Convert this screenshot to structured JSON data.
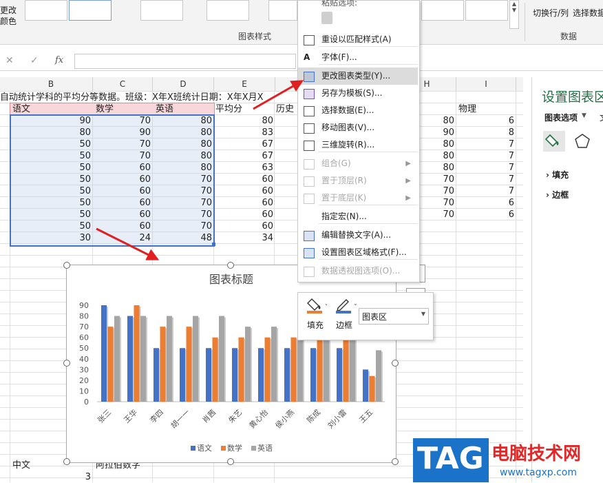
{
  "ribbon": {
    "left_label_1": "更改",
    "left_label_2": "颜色",
    "chart_styles_group": "图表样式",
    "switch_row_col": "切换行/列",
    "select_data": "选择数据",
    "data_group": "数据"
  },
  "formula_bar": {
    "cancel": "✕",
    "enter": "✓",
    "fx": "fx"
  },
  "columns": [
    "B",
    "C",
    "D",
    "E",
    "H",
    "I"
  ],
  "sheet": {
    "title_row": "自动统计学科的平均分等数据。班级：X年X班统计日期：X年X月X",
    "headers": [
      "语文",
      "数学",
      "英语",
      "平均分",
      "历史"
    ],
    "physics_header": "物理",
    "rows": [
      [
        90,
        70,
        80,
        80
      ],
      [
        80,
        90,
        80,
        83
      ],
      [
        50,
        70,
        80,
        67
      ],
      [
        50,
        70,
        80,
        67
      ],
      [
        50,
        60,
        80,
        63
      ],
      [
        50,
        60,
        70,
        60
      ],
      [
        50,
        60,
        70,
        60
      ],
      [
        50,
        60,
        70,
        60
      ],
      [
        50,
        60,
        70,
        60
      ],
      [
        50,
        60,
        70,
        60
      ],
      [
        30,
        24,
        48,
        34
      ]
    ],
    "col_h": [
      80,
      90,
      80,
      80,
      80,
      70,
      70,
      70,
      70
    ],
    "col_i": [
      "6",
      "8",
      "7",
      "7",
      "7",
      "7",
      "7",
      "6",
      "6"
    ],
    "bottom_a": "中文",
    "bottom_c": "阿拉伯数字",
    "bottom_num": "3"
  },
  "chart_data": {
    "type": "bar",
    "title": "图表标题",
    "categories": [
      "张三",
      "王华",
      "李四",
      "胡一一",
      "肖茜",
      "朱艺",
      "黄心怡",
      "侯小燕",
      "陈成",
      "刘小雷",
      "王五"
    ],
    "series": [
      {
        "name": "语文",
        "values": [
          90,
          80,
          50,
          50,
          50,
          50,
          50,
          50,
          50,
          50,
          30
        ],
        "color": "#4472c4"
      },
      {
        "name": "数学",
        "values": [
          70,
          90,
          70,
          70,
          60,
          60,
          60,
          60,
          60,
          60,
          24
        ],
        "color": "#ed7d31"
      },
      {
        "name": "英语",
        "values": [
          80,
          80,
          80,
          80,
          80,
          70,
          70,
          70,
          70,
          70,
          48
        ],
        "color": "#a5a5a5"
      }
    ],
    "ylim": [
      0,
      90
    ],
    "yticks": [
      0,
      10,
      20,
      30,
      40,
      50,
      60,
      70,
      80,
      90
    ],
    "legend": "bottom",
    "grid": false
  },
  "context_menu": {
    "paste_options": "粘贴选项:",
    "items": [
      {
        "label": "重设以匹配样式(A)",
        "disabled": false,
        "icon": "reset-style-icon"
      },
      {
        "label": "字体(F)...",
        "disabled": false,
        "icon": "font-icon"
      },
      {
        "label": "更改图表类型(Y)...",
        "disabled": false,
        "icon": "change-chart-type-icon",
        "highlight": true
      },
      {
        "label": "另存为模板(S)...",
        "disabled": false,
        "icon": "save-template-icon"
      },
      {
        "label": "选择数据(E)...",
        "disabled": false,
        "icon": "select-data-icon"
      },
      {
        "label": "移动图表(V)...",
        "disabled": false,
        "icon": "move-chart-icon"
      },
      {
        "label": "三维旋转(R)...",
        "disabled": false,
        "icon": "3d-rotate-icon"
      },
      {
        "label": "组合(G)",
        "disabled": true,
        "icon": "group-icon",
        "submenu": true
      },
      {
        "label": "置于顶层(R)",
        "disabled": true,
        "icon": "bring-front-icon",
        "submenu": true
      },
      {
        "label": "置于底层(K)",
        "disabled": true,
        "icon": "send-back-icon",
        "submenu": true
      },
      {
        "label": "指定宏(N)...",
        "disabled": false,
        "icon": "none"
      },
      {
        "label": "编辑替换文字(A)...",
        "disabled": false,
        "icon": "alt-text-icon"
      },
      {
        "label": "设置图表区域格式(F)...",
        "disabled": false,
        "icon": "format-area-icon"
      },
      {
        "label": "数据透视图选项(O)...",
        "disabled": true,
        "icon": "pivot-options-icon"
      }
    ]
  },
  "mini_toolbar": {
    "fill": "填充",
    "border": "边框",
    "dropdown_value": "图表区"
  },
  "side_panel": {
    "title": "设置图表区",
    "tab": "图表选项",
    "tab_extra": "文",
    "fill": "填充",
    "border": "边框"
  },
  "watermark": {
    "tag": "TAG",
    "site_name": "电脑技术网",
    "url": "www.tagxp.com"
  },
  "colors": {
    "accent": "#4472c4",
    "arrow": "#e02020",
    "header_fill": "#f7d7d9"
  }
}
